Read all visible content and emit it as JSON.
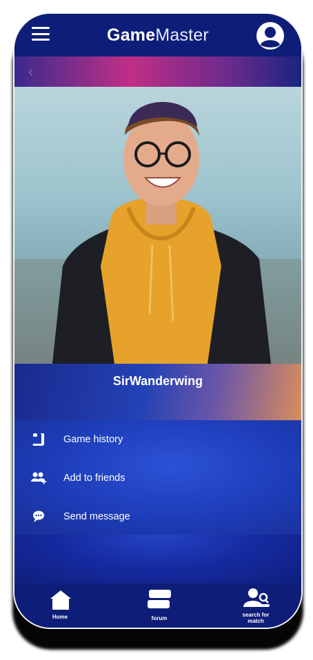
{
  "app": {
    "title_bold": "Game",
    "title_light": "Master"
  },
  "profile": {
    "username": "SirWanderwing"
  },
  "actions": [
    {
      "label": "Game history",
      "icon": "scroll-icon"
    },
    {
      "label": "Add to friends",
      "icon": "add-friends-icon"
    },
    {
      "label": "Send message",
      "icon": "chat-bubble-icon"
    }
  ],
  "tabs": [
    {
      "label": "Home",
      "icon": "home-icon"
    },
    {
      "label": "forum",
      "icon": "forum-icon"
    },
    {
      "label_line1": "search for",
      "label_line2": "match",
      "icon": "search-user-icon"
    }
  ],
  "colors": {
    "header": "#0e1e78",
    "accent_pink": "#c02f86",
    "menu_blue": "#2342b5"
  }
}
